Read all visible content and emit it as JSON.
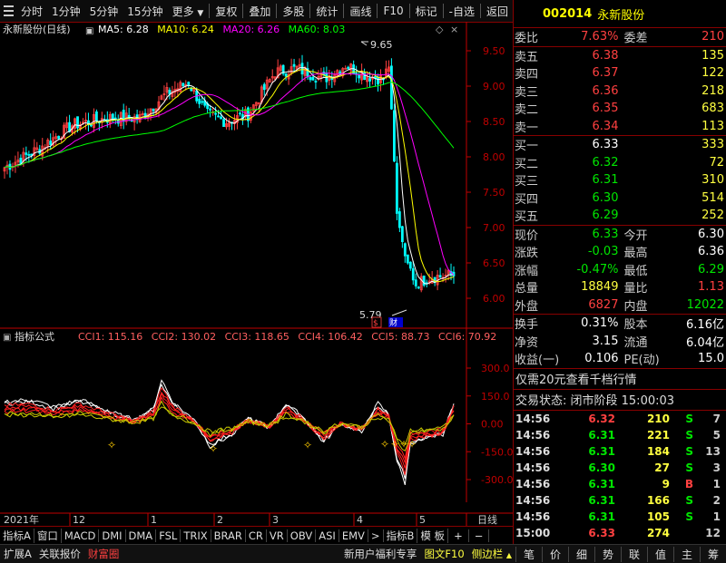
{
  "toolbar": {
    "periods": [
      "分时",
      "1分钟",
      "5分钟",
      "15分钟",
      "更多"
    ],
    "actions": [
      "复权",
      "叠加",
      "多股",
      "统计",
      "画线",
      "F10",
      "标记",
      "-自选",
      "返回"
    ]
  },
  "header": {
    "title": "永新股份(日线)",
    "ma": [
      {
        "label": "MA5: 6.28",
        "color": "#ffffff"
      },
      {
        "label": "MA10: 6.24",
        "color": "#ffff00"
      },
      {
        "label": "MA20: 6.26",
        "color": "#ff00ff"
      },
      {
        "label": "MA60: 8.03",
        "color": "#00ff00"
      }
    ],
    "high_label": "9.65",
    "low_label": "5.79"
  },
  "yaxis": [
    "9.50",
    "9.00",
    "8.50",
    "8.00",
    "7.50",
    "7.00",
    "6.50",
    "6.00"
  ],
  "indicator": {
    "title": "指标公式",
    "values": [
      "CCI1: 115.16",
      "CCI2: 130.02",
      "CCI3: 118.65",
      "CCI4: 106.42",
      "CCI5: 88.73",
      "CCI6: 70.92"
    ],
    "axis": [
      "300.0",
      "150.0",
      "0.00",
      "-150.0",
      "-300.0"
    ]
  },
  "xaxis": {
    "labels": [
      "2021年",
      "12",
      "1",
      "2",
      "3",
      "4",
      "5"
    ],
    "period": "日线"
  },
  "bottom_tabs": [
    "指标A",
    "窗口",
    "MACD",
    "DMI",
    "DMA",
    "FSL",
    "TRIX",
    "BRAR",
    "CR",
    "VR",
    "OBV",
    "ASI",
    "EMV",
    "指标B",
    "模 板",
    "+",
    "−"
  ],
  "footer": {
    "left": [
      "扩展A",
      "关联报价",
      "财富圈"
    ],
    "promo": "新用户福利专享",
    "f10": "图文F10",
    "side": "侧边栏",
    "right_tabs": [
      "笔",
      "价",
      "细",
      "势",
      "联",
      "值",
      "主",
      "筹"
    ]
  },
  "panel": {
    "code": "002014",
    "name": "永新股份",
    "weibi": {
      "label": "委比",
      "value": "7.63%",
      "label2": "委差",
      "value2": "210"
    },
    "asks": [
      {
        "label": "卖五",
        "price": "6.38",
        "vol": "135"
      },
      {
        "label": "卖四",
        "price": "6.37",
        "vol": "122"
      },
      {
        "label": "卖三",
        "price": "6.36",
        "vol": "218"
      },
      {
        "label": "卖二",
        "price": "6.35",
        "vol": "683"
      },
      {
        "label": "卖一",
        "price": "6.34",
        "vol": "113"
      }
    ],
    "bids": [
      {
        "label": "买一",
        "price": "6.33",
        "vol": "333"
      },
      {
        "label": "买二",
        "price": "6.32",
        "vol": "72"
      },
      {
        "label": "买三",
        "price": "6.31",
        "vol": "310"
      },
      {
        "label": "买四",
        "price": "6.30",
        "vol": "514"
      },
      {
        "label": "买五",
        "price": "6.29",
        "vol": "252"
      }
    ],
    "quote": [
      {
        "l": "现价",
        "v": "6.33",
        "l2": "今开",
        "v2": "6.30"
      },
      {
        "l": "涨跌",
        "v": "-0.03",
        "l2": "最高",
        "v2": "6.36"
      },
      {
        "l": "涨幅",
        "v": "-0.47%",
        "l2": "最低",
        "v2": "6.29"
      },
      {
        "l": "总量",
        "v": "18849",
        "l2": "量比",
        "v2": "1.13"
      },
      {
        "l": "外盘",
        "v": "6827",
        "l2": "内盘",
        "v2": "12022"
      }
    ],
    "stats": [
      {
        "l": "换手",
        "v": "0.31%",
        "l2": "股本",
        "v2": "6.16亿"
      },
      {
        "l": "净资",
        "v": "3.15",
        "l2": "流通",
        "v2": "6.04亿"
      },
      {
        "l": "收益(一)",
        "v": "0.106",
        "l2": "PE(动)",
        "v2": "15.0"
      }
    ],
    "promo": "仅需20元查看千档行情",
    "status": "交易状态: 闭市阶段 15:00:03",
    "trades": [
      {
        "t": "14:56",
        "p": "6.32",
        "v": "210",
        "s": "S",
        "n": "7"
      },
      {
        "t": "14:56",
        "p": "6.31",
        "v": "221",
        "s": "S",
        "n": "5"
      },
      {
        "t": "14:56",
        "p": "6.31",
        "v": "184",
        "s": "S",
        "n": "13"
      },
      {
        "t": "14:56",
        "p": "6.30",
        "v": "27",
        "s": "S",
        "n": "3"
      },
      {
        "t": "14:56",
        "p": "6.31",
        "v": "9",
        "s": "B",
        "n": "1"
      },
      {
        "t": "14:56",
        "p": "6.31",
        "v": "166",
        "s": "S",
        "n": "2"
      },
      {
        "t": "14:56",
        "p": "6.31",
        "v": "105",
        "s": "S",
        "n": "1"
      },
      {
        "t": "15:00",
        "p": "6.33",
        "v": "274",
        "s": "",
        "n": "12"
      }
    ]
  },
  "colors": {
    "up": "#ff4040",
    "down": "#00e600",
    "axis": "#c00000",
    "ma5": "#ffffff",
    "ma10": "#ffff00",
    "ma20": "#ff00ff",
    "ma60": "#00ff00"
  }
}
